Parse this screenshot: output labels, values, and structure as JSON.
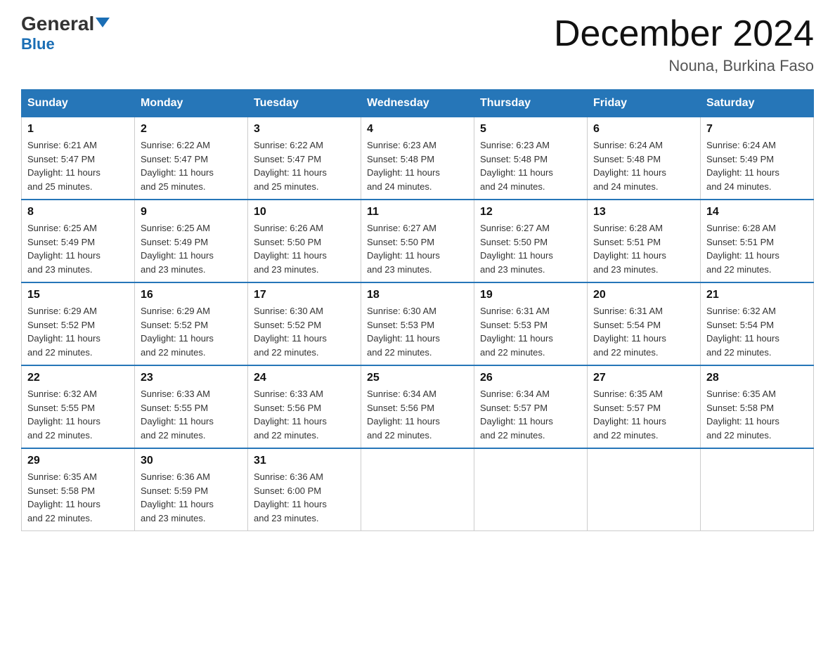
{
  "logo": {
    "text_general": "General",
    "text_blue": "Blue"
  },
  "header": {
    "month": "December 2024",
    "location": "Nouna, Burkina Faso"
  },
  "weekdays": [
    "Sunday",
    "Monday",
    "Tuesday",
    "Wednesday",
    "Thursday",
    "Friday",
    "Saturday"
  ],
  "weeks": [
    [
      {
        "day": "1",
        "sunrise": "6:21 AM",
        "sunset": "5:47 PM",
        "daylight": "11 hours and 25 minutes."
      },
      {
        "day": "2",
        "sunrise": "6:22 AM",
        "sunset": "5:47 PM",
        "daylight": "11 hours and 25 minutes."
      },
      {
        "day": "3",
        "sunrise": "6:22 AM",
        "sunset": "5:47 PM",
        "daylight": "11 hours and 25 minutes."
      },
      {
        "day": "4",
        "sunrise": "6:23 AM",
        "sunset": "5:48 PM",
        "daylight": "11 hours and 24 minutes."
      },
      {
        "day": "5",
        "sunrise": "6:23 AM",
        "sunset": "5:48 PM",
        "daylight": "11 hours and 24 minutes."
      },
      {
        "day": "6",
        "sunrise": "6:24 AM",
        "sunset": "5:48 PM",
        "daylight": "11 hours and 24 minutes."
      },
      {
        "day": "7",
        "sunrise": "6:24 AM",
        "sunset": "5:49 PM",
        "daylight": "11 hours and 24 minutes."
      }
    ],
    [
      {
        "day": "8",
        "sunrise": "6:25 AM",
        "sunset": "5:49 PM",
        "daylight": "11 hours and 23 minutes."
      },
      {
        "day": "9",
        "sunrise": "6:25 AM",
        "sunset": "5:49 PM",
        "daylight": "11 hours and 23 minutes."
      },
      {
        "day": "10",
        "sunrise": "6:26 AM",
        "sunset": "5:50 PM",
        "daylight": "11 hours and 23 minutes."
      },
      {
        "day": "11",
        "sunrise": "6:27 AM",
        "sunset": "5:50 PM",
        "daylight": "11 hours and 23 minutes."
      },
      {
        "day": "12",
        "sunrise": "6:27 AM",
        "sunset": "5:50 PM",
        "daylight": "11 hours and 23 minutes."
      },
      {
        "day": "13",
        "sunrise": "6:28 AM",
        "sunset": "5:51 PM",
        "daylight": "11 hours and 23 minutes."
      },
      {
        "day": "14",
        "sunrise": "6:28 AM",
        "sunset": "5:51 PM",
        "daylight": "11 hours and 22 minutes."
      }
    ],
    [
      {
        "day": "15",
        "sunrise": "6:29 AM",
        "sunset": "5:52 PM",
        "daylight": "11 hours and 22 minutes."
      },
      {
        "day": "16",
        "sunrise": "6:29 AM",
        "sunset": "5:52 PM",
        "daylight": "11 hours and 22 minutes."
      },
      {
        "day": "17",
        "sunrise": "6:30 AM",
        "sunset": "5:52 PM",
        "daylight": "11 hours and 22 minutes."
      },
      {
        "day": "18",
        "sunrise": "6:30 AM",
        "sunset": "5:53 PM",
        "daylight": "11 hours and 22 minutes."
      },
      {
        "day": "19",
        "sunrise": "6:31 AM",
        "sunset": "5:53 PM",
        "daylight": "11 hours and 22 minutes."
      },
      {
        "day": "20",
        "sunrise": "6:31 AM",
        "sunset": "5:54 PM",
        "daylight": "11 hours and 22 minutes."
      },
      {
        "day": "21",
        "sunrise": "6:32 AM",
        "sunset": "5:54 PM",
        "daylight": "11 hours and 22 minutes."
      }
    ],
    [
      {
        "day": "22",
        "sunrise": "6:32 AM",
        "sunset": "5:55 PM",
        "daylight": "11 hours and 22 minutes."
      },
      {
        "day": "23",
        "sunrise": "6:33 AM",
        "sunset": "5:55 PM",
        "daylight": "11 hours and 22 minutes."
      },
      {
        "day": "24",
        "sunrise": "6:33 AM",
        "sunset": "5:56 PM",
        "daylight": "11 hours and 22 minutes."
      },
      {
        "day": "25",
        "sunrise": "6:34 AM",
        "sunset": "5:56 PM",
        "daylight": "11 hours and 22 minutes."
      },
      {
        "day": "26",
        "sunrise": "6:34 AM",
        "sunset": "5:57 PM",
        "daylight": "11 hours and 22 minutes."
      },
      {
        "day": "27",
        "sunrise": "6:35 AM",
        "sunset": "5:57 PM",
        "daylight": "11 hours and 22 minutes."
      },
      {
        "day": "28",
        "sunrise": "6:35 AM",
        "sunset": "5:58 PM",
        "daylight": "11 hours and 22 minutes."
      }
    ],
    [
      {
        "day": "29",
        "sunrise": "6:35 AM",
        "sunset": "5:58 PM",
        "daylight": "11 hours and 22 minutes."
      },
      {
        "day": "30",
        "sunrise": "6:36 AM",
        "sunset": "5:59 PM",
        "daylight": "11 hours and 23 minutes."
      },
      {
        "day": "31",
        "sunrise": "6:36 AM",
        "sunset": "6:00 PM",
        "daylight": "11 hours and 23 minutes."
      },
      null,
      null,
      null,
      null
    ]
  ],
  "labels": {
    "sunrise": "Sunrise:",
    "sunset": "Sunset:",
    "daylight": "Daylight:"
  }
}
